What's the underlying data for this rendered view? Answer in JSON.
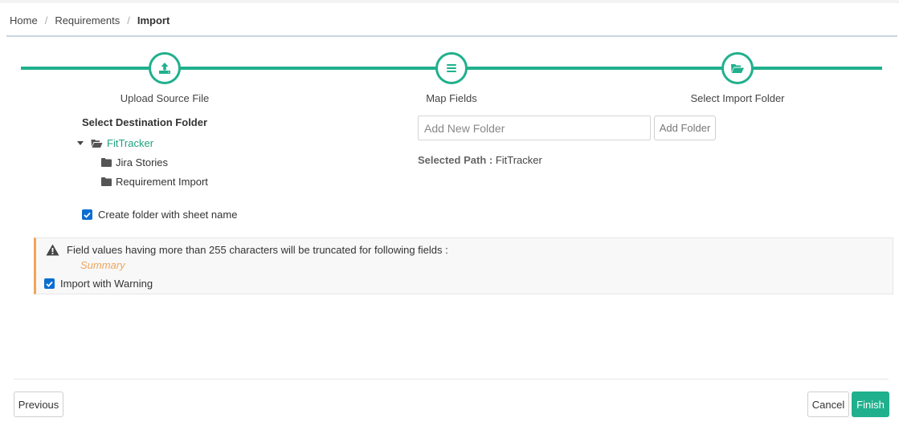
{
  "breadcrumb": {
    "items": [
      "Home",
      "Requirements",
      "Import"
    ],
    "separator": "/"
  },
  "stepper": {
    "accent_color": "#20b08d",
    "steps": [
      {
        "label": "Upload Source File",
        "icon": "upload-icon"
      },
      {
        "label": "Map Fields",
        "icon": "list-icon"
      },
      {
        "label": "Select Import Folder",
        "icon": "folder-open-icon"
      }
    ]
  },
  "destination": {
    "title": "Select Destination Folder",
    "tree": {
      "root": "FitTracker",
      "children": [
        "Jira Stories",
        "Requirement Import"
      ]
    },
    "create_folder": {
      "label": "Create folder with sheet name",
      "checked": true
    }
  },
  "new_folder": {
    "placeholder": "Add New Folder",
    "value": "",
    "button_label": "Add Folder"
  },
  "selected_path": {
    "label": "Selected Path :",
    "value": "FitTracker"
  },
  "warning": {
    "message": "Field values having more than 255 characters will be truncated for following fields :",
    "fields": [
      "Summary"
    ],
    "import_with_warning": {
      "label": "Import with Warning",
      "checked": true
    },
    "accent_color": "#f0a45a"
  },
  "footer": {
    "previous_label": "Previous",
    "cancel_label": "Cancel",
    "finish_label": "Finish"
  }
}
